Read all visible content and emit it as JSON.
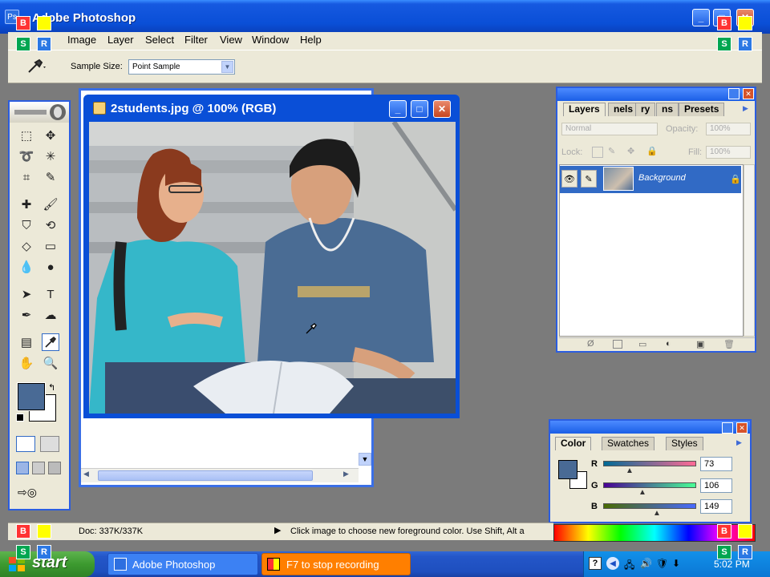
{
  "app": {
    "title": "Adobe Photoshop"
  },
  "menu": [
    "Image",
    "Layer",
    "Select",
    "Filter",
    "View",
    "Window",
    "Help"
  ],
  "options": {
    "sample_size_label": "Sample Size:",
    "sample_size_value": "Point Sample"
  },
  "document": {
    "title": "2students.jpg @ 100% (RGB)"
  },
  "layers_panel": {
    "tabs": [
      "Layers",
      "nels",
      "ry",
      "ns",
      "Presets"
    ],
    "blend_mode": "Normal",
    "opacity_label": "Opacity:",
    "opacity_value": "100%",
    "lock_label": "Lock:",
    "fill_label": "Fill:",
    "fill_value": "100%",
    "layer_name": "Background"
  },
  "color_panel": {
    "tabs": [
      "Color",
      "Swatches",
      "Styles"
    ],
    "channels": [
      {
        "label": "R",
        "value": "73"
      },
      {
        "label": "G",
        "value": "106"
      },
      {
        "label": "B",
        "value": "149"
      }
    ],
    "foreground": "#496a95"
  },
  "status": {
    "doc_size": "Doc: 337K/337K",
    "hint": "Click image to choose new foreground color.  Use Shift, Alt a"
  },
  "taskbar": {
    "start_label": "start",
    "items": [
      "Adobe Photoshop",
      "F7 to stop recording"
    ],
    "clock": "5:02 PM"
  },
  "overlay_badges": {
    "b": "B",
    "s": "S",
    "r": "R"
  }
}
